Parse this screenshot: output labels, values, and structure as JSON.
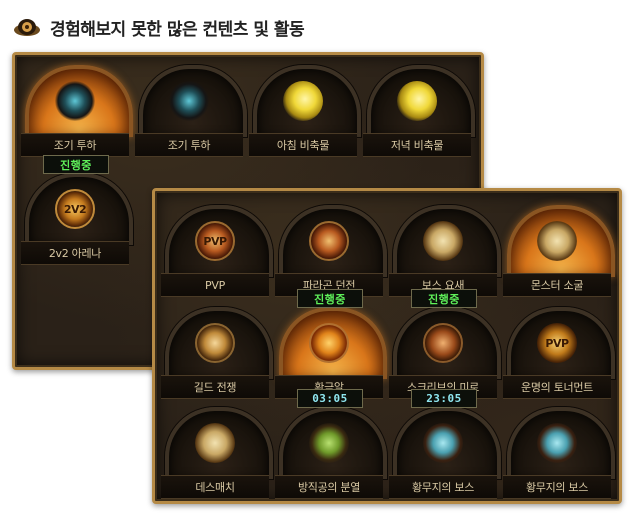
{
  "header": {
    "title": "경험해보지 못한 많은 컨텐츠 및 활동",
    "icon": "helmet-icon"
  },
  "colors": {
    "accent_gold": "#b58a46",
    "status_green": "#5ff05a",
    "timer_cyan": "#8fe6f0",
    "label_text": "#d9c9a4"
  },
  "back_panel": {
    "tiles": [
      {
        "label": "조기 투하",
        "icon": "spiked-orb-icon",
        "lit": true
      },
      {
        "label": "조기 투하",
        "icon": "spiked-orb-icon",
        "lit": false
      },
      {
        "label": "아침 비축물",
        "icon": "yellow-bird-icon",
        "lit": false
      },
      {
        "label": "저녁 비축물",
        "icon": "yellow-bird-icon",
        "lit": false
      },
      {
        "label": "2v2 아레나",
        "icon": "2v2-badge-icon",
        "icon_text": "2V2",
        "lit": false,
        "badge": "진행중"
      }
    ]
  },
  "front_panel": {
    "tiles": [
      {
        "label": "PVP",
        "icon": "pvp-emblem-icon",
        "icon_text": "PVP",
        "lit": false
      },
      {
        "label": "파라곤 던전",
        "icon": "paragon-crest-icon",
        "lit": false
      },
      {
        "label": "보스 요새",
        "icon": "boss-skull-icon",
        "lit": false
      },
      {
        "label": "몬스터 소굴",
        "icon": "monster-skull-icon",
        "lit": true
      },
      {
        "label": "길드 전쟁",
        "icon": "war-horn-icon",
        "lit": false
      },
      {
        "label": "황금알",
        "icon": "golden-egg-icon",
        "lit": true,
        "badge": "진행중"
      },
      {
        "label": "스크리브의 미로",
        "icon": "book-maze-icon",
        "lit": false,
        "badge": "진행중"
      },
      {
        "label": "운명의 토너먼트",
        "icon": "pvp-trophy-icon",
        "icon_text": "PVP",
        "lit": false
      },
      {
        "label": "데스매치",
        "icon": "deathmatch-skull-icon",
        "lit": false
      },
      {
        "label": "방직공의 분열",
        "icon": "weaver-creature-icon",
        "lit": false,
        "timer": "03:05"
      },
      {
        "label": "황무지의 보스",
        "icon": "wasteland-boss-icon",
        "lit": false,
        "timer": "23:05"
      },
      {
        "label": "황무지의 보스",
        "icon": "wasteland-boss-icon",
        "lit": false
      }
    ]
  }
}
